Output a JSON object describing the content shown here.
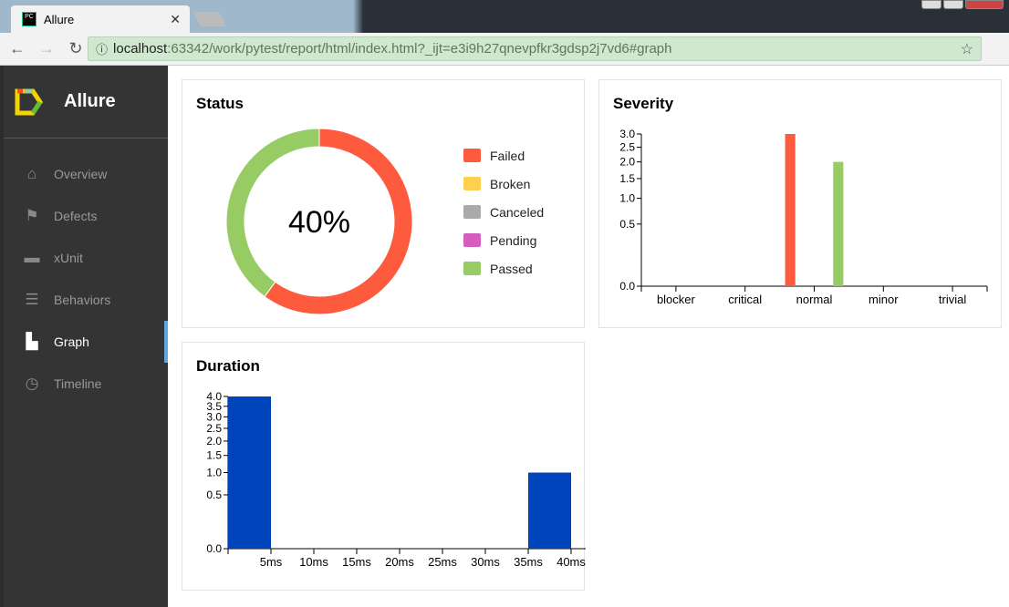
{
  "browser": {
    "tab_title": "Allure",
    "tab_icon": "PC",
    "url_host": "localhost",
    "url_rest": ":63342/work/pytest/report/html/index.html?_ijt=e3i9h27qnevpfkr3gdsp2j7vd6#graph"
  },
  "sidebar": {
    "brand": "Allure",
    "items": [
      {
        "label": "Overview",
        "icon": "home-icon"
      },
      {
        "label": "Defects",
        "icon": "flag-icon"
      },
      {
        "label": "xUnit",
        "icon": "briefcase-icon"
      },
      {
        "label": "Behaviors",
        "icon": "list-icon"
      },
      {
        "label": "Graph",
        "icon": "bar-chart-icon",
        "active": true
      },
      {
        "label": "Timeline",
        "icon": "clock-icon"
      }
    ]
  },
  "status": {
    "title": "Status",
    "percent_label": "40%",
    "legend": [
      {
        "label": "Failed",
        "color": "#fd5a3e"
      },
      {
        "label": "Broken",
        "color": "#ffd050"
      },
      {
        "label": "Canceled",
        "color": "#aaaaaa"
      },
      {
        "label": "Pending",
        "color": "#d35ebe"
      },
      {
        "label": "Passed",
        "color": "#97cc64"
      }
    ]
  },
  "chart_data": [
    {
      "type": "pie",
      "title": "Status",
      "donut": true,
      "center_label": "40%",
      "categories": [
        "Failed",
        "Broken",
        "Canceled",
        "Pending",
        "Passed"
      ],
      "values": [
        3,
        0,
        0,
        0,
        2
      ],
      "colors": [
        "#fd5a3e",
        "#ffd050",
        "#aaaaaa",
        "#d35ebe",
        "#97cc64"
      ]
    },
    {
      "type": "bar",
      "title": "Severity",
      "y_scale": "sqrt",
      "ylim": [
        0,
        3
      ],
      "yticks": [
        "0.0",
        "0.5",
        "1.0",
        "1.5",
        "2.0",
        "2.5",
        "3.0"
      ],
      "categories": [
        "blocker",
        "critical",
        "normal",
        "minor",
        "trivial"
      ],
      "series": [
        {
          "name": "Failed",
          "color": "#fd5a3e",
          "values": [
            0,
            0,
            3,
            0,
            0
          ]
        },
        {
          "name": "Broken",
          "color": "#ffd050",
          "values": [
            0,
            0,
            0,
            0,
            0
          ]
        },
        {
          "name": "Canceled",
          "color": "#aaaaaa",
          "values": [
            0,
            0,
            0,
            0,
            0
          ]
        },
        {
          "name": "Pending",
          "color": "#d35ebe",
          "values": [
            0,
            0,
            0,
            0,
            0
          ]
        },
        {
          "name": "Passed",
          "color": "#97cc64",
          "values": [
            0,
            0,
            2,
            0,
            0
          ]
        }
      ]
    },
    {
      "type": "bar",
      "title": "Duration",
      "y_scale": "sqrt",
      "ylim": [
        0,
        4
      ],
      "yticks": [
        "0.0",
        "0.5",
        "1.0",
        "1.5",
        "2.0",
        "2.5",
        "3.0",
        "3.5",
        "4.0"
      ],
      "xlim_ms": [
        0,
        40
      ],
      "xticks": [
        "5ms",
        "10ms",
        "15ms",
        "20ms",
        "25ms",
        "30ms",
        "35ms",
        "40ms"
      ],
      "color": "#0044bb",
      "bins": [
        {
          "from_ms": 0,
          "to_ms": 5,
          "count": 4
        },
        {
          "from_ms": 35,
          "to_ms": 40,
          "count": 1
        }
      ]
    }
  ]
}
